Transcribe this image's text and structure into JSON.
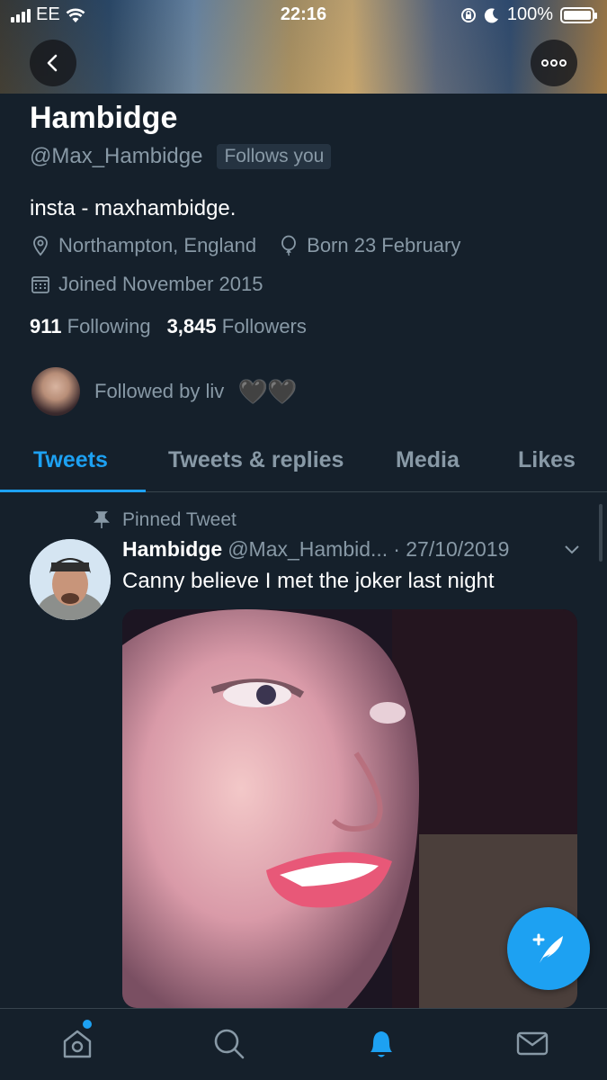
{
  "status_bar": {
    "carrier": "EE",
    "time": "22:16",
    "battery": "100%"
  },
  "header": {
    "back_icon": "chevron-left-icon",
    "more_icon": "more-dots-icon"
  },
  "profile": {
    "name": "Hambidge",
    "handle": "@Max_Hambidge",
    "follows_you": "Follows you",
    "bio": "insta - maxhambidge.",
    "location": "Northampton, England",
    "birthday": "Born 23 February",
    "joined": "Joined November 2015",
    "following_count": "911",
    "following_label": "Following",
    "followers_count": "3,845",
    "followers_label": "Followers",
    "followed_by": "Followed by liv",
    "followed_by_emoji": "🖤🖤"
  },
  "tabs": [
    {
      "label": "Tweets",
      "active": true
    },
    {
      "label": "Tweets & replies",
      "active": false
    },
    {
      "label": "Media",
      "active": false
    },
    {
      "label": "Likes",
      "active": false
    }
  ],
  "pinned_tweet": {
    "pinned_label": "Pinned Tweet",
    "name": "Hambidge",
    "handle": "@Max_Hambid...",
    "date": "· 27/10/2019",
    "text": "Canny believe I met the joker last night"
  },
  "bottom_nav": [
    "home-icon",
    "search-icon",
    "notifications-icon",
    "messages-icon"
  ],
  "colors": {
    "background": "#15202b",
    "accent": "#1da1f2",
    "secondary_text": "#8899a6"
  }
}
